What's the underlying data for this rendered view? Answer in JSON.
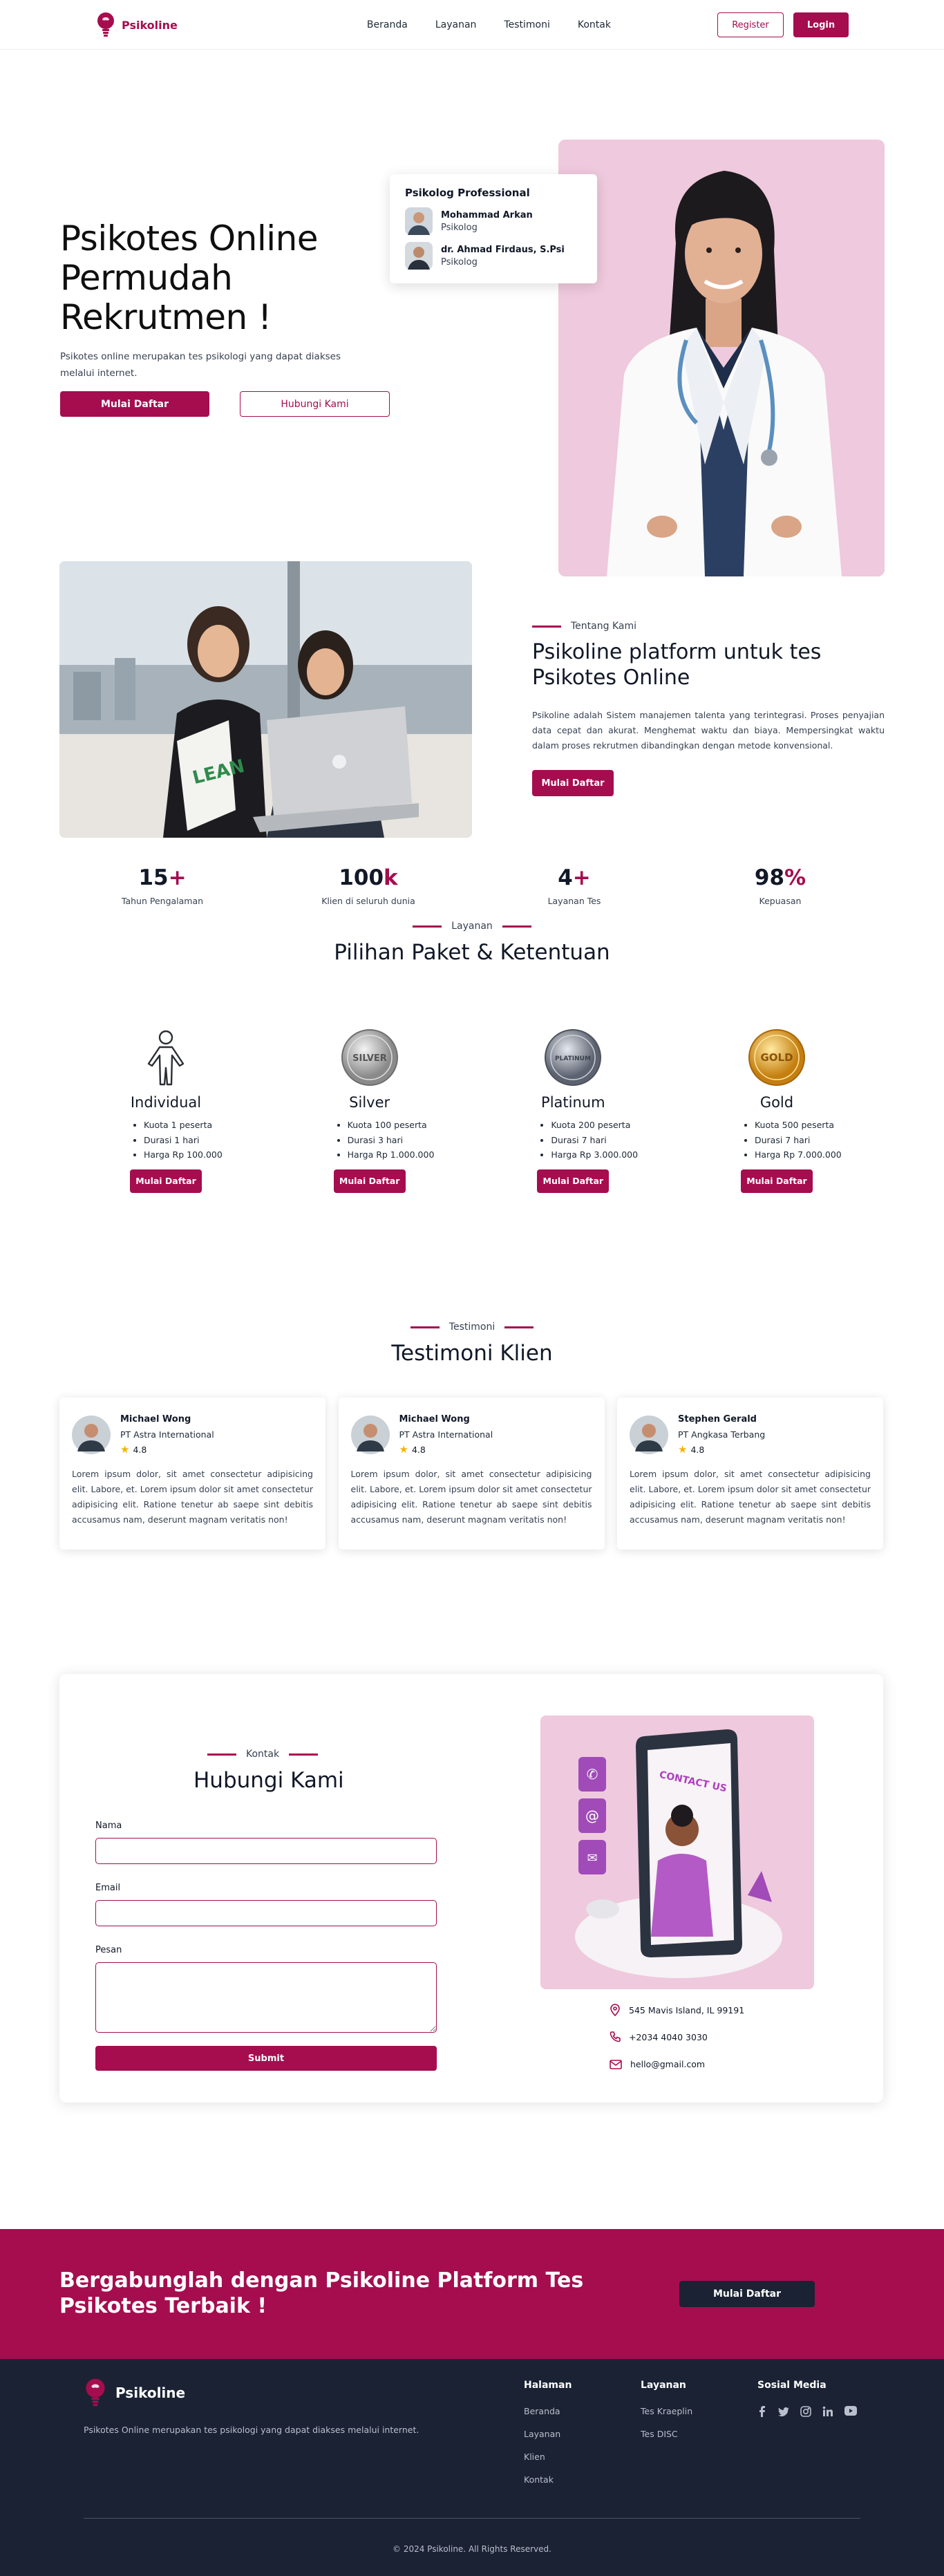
{
  "nav": {
    "brand": "Psikoline",
    "menu": [
      "Beranda",
      "Layanan",
      "Testimoni",
      "Kontak"
    ],
    "register": "Register",
    "login": "Login"
  },
  "hero": {
    "title_line1": "Psikotes Online",
    "title_line2": "Permudah",
    "title_line3": "Rekrutmen !",
    "subtitle": "Psikotes online merupakan tes psikologi yang dapat diakses melalui internet.",
    "primary_btn": "Mulai Daftar",
    "secondary_btn": "Hubungi Kami",
    "card_title": "Psikolog Professional",
    "psychologists": [
      {
        "name": "Mohammad Arkan",
        "role": "Psikolog"
      },
      {
        "name": "dr. Ahmad Firdaus, S.Psi",
        "role": "Psikolog"
      }
    ]
  },
  "about": {
    "eyebrow": "Tentang Kami",
    "title": "Psikoline platform untuk tes Psikotes Online",
    "text": "Psikoline adalah Sistem manajemen talenta yang terintegrasi. Proses penyajian data cepat dan akurat. Menghemat waktu dan biaya. Mempersingkat waktu dalam proses rekrutmen dibandingkan dengan metode konvensional.",
    "button": "Mulai Daftar",
    "stats": [
      {
        "value": "15",
        "suffix": "+",
        "label": "Tahun Pengalaman"
      },
      {
        "value": "100",
        "suffix": "k",
        "label": "Klien di seluruh dunia"
      },
      {
        "value": "4",
        "suffix": "+",
        "label": "Layanan Tes"
      },
      {
        "value": "98",
        "suffix": "%",
        "label": "Kepuasan"
      }
    ]
  },
  "services": {
    "eyebrow": "Layanan",
    "title": "Pilihan Paket & Ketentuan",
    "packages": [
      {
        "name": "Individual",
        "icon": "person-icon",
        "items": [
          "Kuota 1 peserta",
          "Durasi 1 hari",
          "Harga Rp 100.000"
        ],
        "button": "Mulai Daftar"
      },
      {
        "name": "Silver",
        "icon": "silver-medal-icon",
        "badge": "SILVER",
        "items": [
          "Kuota 100 peserta",
          "Durasi 3 hari",
          "Harga Rp 1.000.000"
        ],
        "button": "Mulai Daftar"
      },
      {
        "name": "Platinum",
        "icon": "platinum-medal-icon",
        "badge": "PLATINUM",
        "items": [
          "Kuota 200 peserta",
          "Durasi 7 hari",
          "Harga Rp 3.000.000"
        ],
        "button": "Mulai Daftar"
      },
      {
        "name": "Gold",
        "icon": "gold-medal-icon",
        "badge": "GOLD",
        "items": [
          "Kuota 500 peserta",
          "Durasi 7 hari",
          "Harga Rp 7.000.000"
        ],
        "button": "Mulai Daftar"
      }
    ]
  },
  "testimonials": {
    "eyebrow": "Testimoni",
    "title": "Testimoni Klien",
    "items": [
      {
        "name": "Michael Wong",
        "company": "PT Astra International",
        "rating": "4.8",
        "text": "Lorem ipsum dolor, sit amet consectetur adipisicing elit. Labore, et. Lorem ipsum dolor sit amet consectetur adipisicing elit. Ratione tenetur ab saepe sint debitis accusamus nam, deserunt magnam veritatis non!"
      },
      {
        "name": "Michael Wong",
        "company": "PT Astra International",
        "rating": "4.8",
        "text": "Lorem ipsum dolor, sit amet consectetur adipisicing elit. Labore, et. Lorem ipsum dolor sit amet consectetur adipisicing elit. Ratione tenetur ab saepe sint debitis accusamus nam, deserunt magnam veritatis non!"
      },
      {
        "name": "Stephen Gerald",
        "company": "PT Angkasa Terbang",
        "rating": "4.8",
        "text": "Lorem ipsum dolor, sit amet consectetur adipisicing elit. Labore, et. Lorem ipsum dolor sit amet consectetur adipisicing elit. Ratione tenetur ab saepe sint debitis accusamus nam, deserunt magnam veritatis non!"
      }
    ]
  },
  "contact": {
    "eyebrow": "Kontak",
    "title": "Hubungi Kami",
    "name_label": "Nama",
    "email_label": "Email",
    "message_label": "Pesan",
    "submit": "Submit",
    "image_caption": "CONTACT US",
    "address": "545 Mavis Island, IL 99191",
    "phone": "+2034 4040 3030",
    "email": "hello@gmail.com"
  },
  "cta": {
    "title": "Bergabunglah dengan Psikoline Platform Tes Psikotes Terbaik !",
    "button": "Mulai Daftar"
  },
  "footer": {
    "brand": "Psikoline",
    "description": "Psikotes Online merupakan tes psikologi yang dapat diakses melalui internet.",
    "col1_title": "Halaman",
    "col1_links": [
      "Beranda",
      "Layanan",
      "Klien",
      "Kontak"
    ],
    "col2_title": "Layanan",
    "col2_links": [
      "Tes Kraeplin",
      "Tes DISC"
    ],
    "col3_title": "Sosial Media",
    "social": [
      "facebook-icon",
      "twitter-icon",
      "instagram-icon",
      "linkedin-icon",
      "youtube-icon"
    ],
    "copyright": "© 2024 Psikoline. All Rights Reserved."
  },
  "colors": {
    "brand": "#a50d4f",
    "dark": "#1b2233",
    "pink_bg": "#efc9dd"
  }
}
